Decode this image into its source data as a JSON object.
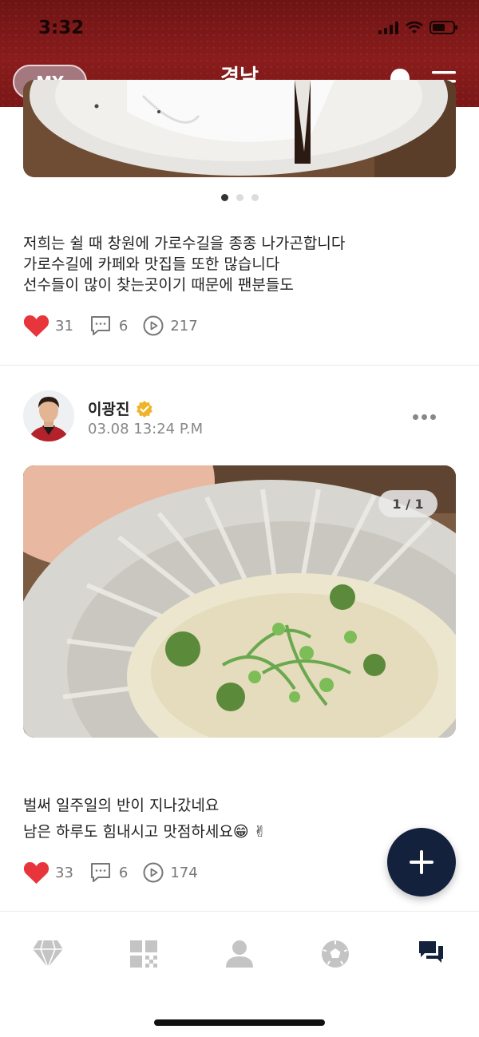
{
  "status_bar": {
    "time": "3:32"
  },
  "header": {
    "my_label": "MY",
    "title": "경남"
  },
  "post1": {
    "pagination": {
      "count": 3,
      "active": 0
    },
    "text_lines": [
      "저희는 쉴 때 창원에 가로수길을 종종 나가곤합니다",
      "가로수길에 카페와 맛집들 또한 많습니다",
      "선수들이 많이 찾는곳이기 때문에 팬분들도"
    ],
    "likes": "31",
    "comments": "6",
    "views": "217"
  },
  "post2": {
    "author": "이광진",
    "date": "03.08 13:24 P.M",
    "image_counter": "1 / 1",
    "text_lines": [
      "벌써 일주일의 반이 지나갔네요",
      "남은 하루도 힘내시고 맛점하세요😁 ✌"
    ],
    "likes": "33",
    "comments": "6",
    "views": "174"
  },
  "colors": {
    "header": "#8a1c1c",
    "heart": "#e8343b",
    "fab": "#14213d",
    "active_tab": "#14213d",
    "inactive_tab": "#c4c4c4"
  },
  "tabbar": {
    "icons": [
      "diamond-icon",
      "qr-grid-icon",
      "person-icon",
      "soccer-ball-icon",
      "chat-icon"
    ],
    "active_index": 4
  }
}
